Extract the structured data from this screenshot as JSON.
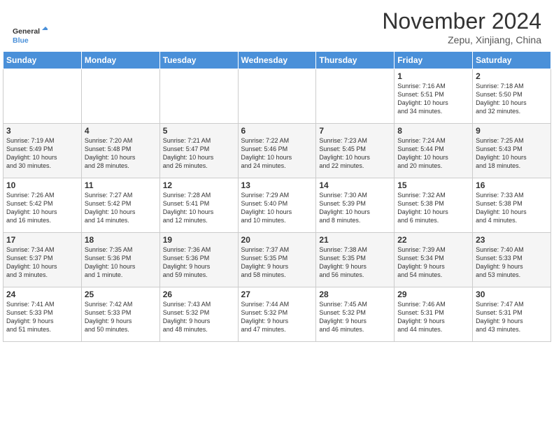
{
  "header": {
    "logo_text_general": "General",
    "logo_text_blue": "Blue",
    "month_year": "November 2024",
    "location": "Zepu, Xinjiang, China"
  },
  "days_of_week": [
    "Sunday",
    "Monday",
    "Tuesday",
    "Wednesday",
    "Thursday",
    "Friday",
    "Saturday"
  ],
  "weeks": [
    [
      {
        "day": "",
        "info": ""
      },
      {
        "day": "",
        "info": ""
      },
      {
        "day": "",
        "info": ""
      },
      {
        "day": "",
        "info": ""
      },
      {
        "day": "",
        "info": ""
      },
      {
        "day": "1",
        "info": "Sunrise: 7:16 AM\nSunset: 5:51 PM\nDaylight: 10 hours\nand 34 minutes."
      },
      {
        "day": "2",
        "info": "Sunrise: 7:18 AM\nSunset: 5:50 PM\nDaylight: 10 hours\nand 32 minutes."
      }
    ],
    [
      {
        "day": "3",
        "info": "Sunrise: 7:19 AM\nSunset: 5:49 PM\nDaylight: 10 hours\nand 30 minutes."
      },
      {
        "day": "4",
        "info": "Sunrise: 7:20 AM\nSunset: 5:48 PM\nDaylight: 10 hours\nand 28 minutes."
      },
      {
        "day": "5",
        "info": "Sunrise: 7:21 AM\nSunset: 5:47 PM\nDaylight: 10 hours\nand 26 minutes."
      },
      {
        "day": "6",
        "info": "Sunrise: 7:22 AM\nSunset: 5:46 PM\nDaylight: 10 hours\nand 24 minutes."
      },
      {
        "day": "7",
        "info": "Sunrise: 7:23 AM\nSunset: 5:45 PM\nDaylight: 10 hours\nand 22 minutes."
      },
      {
        "day": "8",
        "info": "Sunrise: 7:24 AM\nSunset: 5:44 PM\nDaylight: 10 hours\nand 20 minutes."
      },
      {
        "day": "9",
        "info": "Sunrise: 7:25 AM\nSunset: 5:43 PM\nDaylight: 10 hours\nand 18 minutes."
      }
    ],
    [
      {
        "day": "10",
        "info": "Sunrise: 7:26 AM\nSunset: 5:42 PM\nDaylight: 10 hours\nand 16 minutes."
      },
      {
        "day": "11",
        "info": "Sunrise: 7:27 AM\nSunset: 5:42 PM\nDaylight: 10 hours\nand 14 minutes."
      },
      {
        "day": "12",
        "info": "Sunrise: 7:28 AM\nSunset: 5:41 PM\nDaylight: 10 hours\nand 12 minutes."
      },
      {
        "day": "13",
        "info": "Sunrise: 7:29 AM\nSunset: 5:40 PM\nDaylight: 10 hours\nand 10 minutes."
      },
      {
        "day": "14",
        "info": "Sunrise: 7:30 AM\nSunset: 5:39 PM\nDaylight: 10 hours\nand 8 minutes."
      },
      {
        "day": "15",
        "info": "Sunrise: 7:32 AM\nSunset: 5:38 PM\nDaylight: 10 hours\nand 6 minutes."
      },
      {
        "day": "16",
        "info": "Sunrise: 7:33 AM\nSunset: 5:38 PM\nDaylight: 10 hours\nand 4 minutes."
      }
    ],
    [
      {
        "day": "17",
        "info": "Sunrise: 7:34 AM\nSunset: 5:37 PM\nDaylight: 10 hours\nand 3 minutes."
      },
      {
        "day": "18",
        "info": "Sunrise: 7:35 AM\nSunset: 5:36 PM\nDaylight: 10 hours\nand 1 minute."
      },
      {
        "day": "19",
        "info": "Sunrise: 7:36 AM\nSunset: 5:36 PM\nDaylight: 9 hours\nand 59 minutes."
      },
      {
        "day": "20",
        "info": "Sunrise: 7:37 AM\nSunset: 5:35 PM\nDaylight: 9 hours\nand 58 minutes."
      },
      {
        "day": "21",
        "info": "Sunrise: 7:38 AM\nSunset: 5:35 PM\nDaylight: 9 hours\nand 56 minutes."
      },
      {
        "day": "22",
        "info": "Sunrise: 7:39 AM\nSunset: 5:34 PM\nDaylight: 9 hours\nand 54 minutes."
      },
      {
        "day": "23",
        "info": "Sunrise: 7:40 AM\nSunset: 5:33 PM\nDaylight: 9 hours\nand 53 minutes."
      }
    ],
    [
      {
        "day": "24",
        "info": "Sunrise: 7:41 AM\nSunset: 5:33 PM\nDaylight: 9 hours\nand 51 minutes."
      },
      {
        "day": "25",
        "info": "Sunrise: 7:42 AM\nSunset: 5:33 PM\nDaylight: 9 hours\nand 50 minutes."
      },
      {
        "day": "26",
        "info": "Sunrise: 7:43 AM\nSunset: 5:32 PM\nDaylight: 9 hours\nand 48 minutes."
      },
      {
        "day": "27",
        "info": "Sunrise: 7:44 AM\nSunset: 5:32 PM\nDaylight: 9 hours\nand 47 minutes."
      },
      {
        "day": "28",
        "info": "Sunrise: 7:45 AM\nSunset: 5:32 PM\nDaylight: 9 hours\nand 46 minutes."
      },
      {
        "day": "29",
        "info": "Sunrise: 7:46 AM\nSunset: 5:31 PM\nDaylight: 9 hours\nand 44 minutes."
      },
      {
        "day": "30",
        "info": "Sunrise: 7:47 AM\nSunset: 5:31 PM\nDaylight: 9 hours\nand 43 minutes."
      }
    ]
  ]
}
